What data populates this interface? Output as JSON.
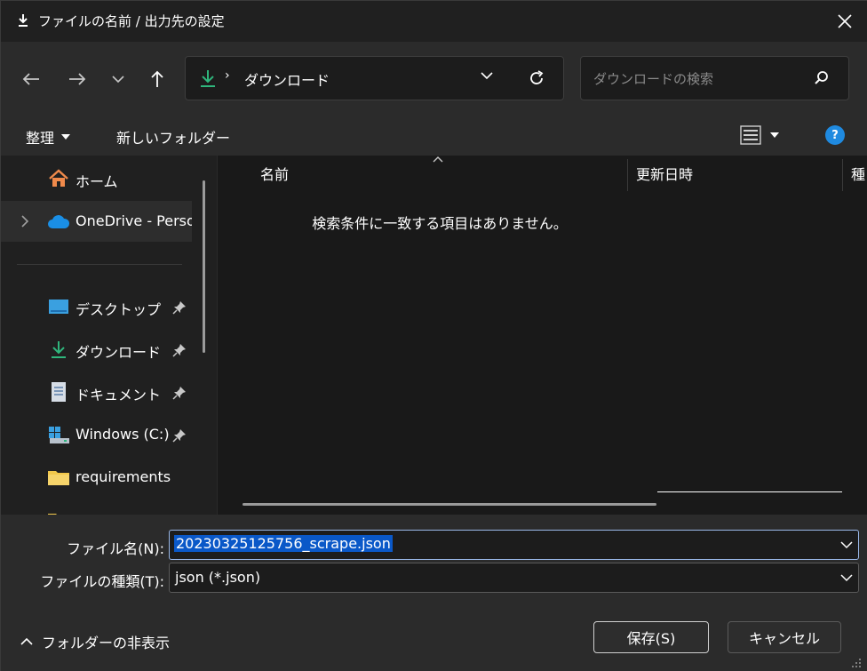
{
  "window": {
    "title": "ファイルの名前 / 出力先の設定",
    "close_icon": "close-icon"
  },
  "nav": {
    "back_icon": "arrow-left-icon",
    "forward_icon": "arrow-right-icon",
    "recent_icon": "chevron-down-icon",
    "up_icon": "arrow-up-icon",
    "address": {
      "separator": "›",
      "location": "ダウンロード"
    },
    "search": {
      "placeholder": "ダウンロードの検索"
    }
  },
  "commands": {
    "organize": "整理",
    "new_folder": "新しいフォルダー"
  },
  "sidebar": {
    "home": "ホーム",
    "onedrive": "OneDrive - Perso",
    "quick": [
      {
        "label": "デスクトップ",
        "icon": "desktop-icon"
      },
      {
        "label": "ダウンロード",
        "icon": "download-icon"
      },
      {
        "label": "ドキュメント",
        "icon": "document-icon"
      },
      {
        "label": "Windows (C:)",
        "icon": "drive-icon"
      },
      {
        "label": "requirements",
        "icon": "folder-icon"
      }
    ]
  },
  "content": {
    "columns": {
      "name": "名前",
      "modified": "更新日時",
      "type": "種"
    },
    "empty_message": "検索条件に一致する項目はありません。"
  },
  "form": {
    "filename_label": "ファイル名(N):",
    "filename_value": "20230325125756_scrape.json",
    "filetype_label": "ファイルの種類(T):",
    "filetype_value": "json (*.json)"
  },
  "footer": {
    "hide_folders": "フォルダーの非表示",
    "save": "保存(S)",
    "cancel": "キャンセル"
  },
  "colors": {
    "accent": "#0a58c8",
    "help": "#1f8ae0",
    "download_green": "#2fb67c",
    "folder_yellow": "#f2c84b"
  }
}
